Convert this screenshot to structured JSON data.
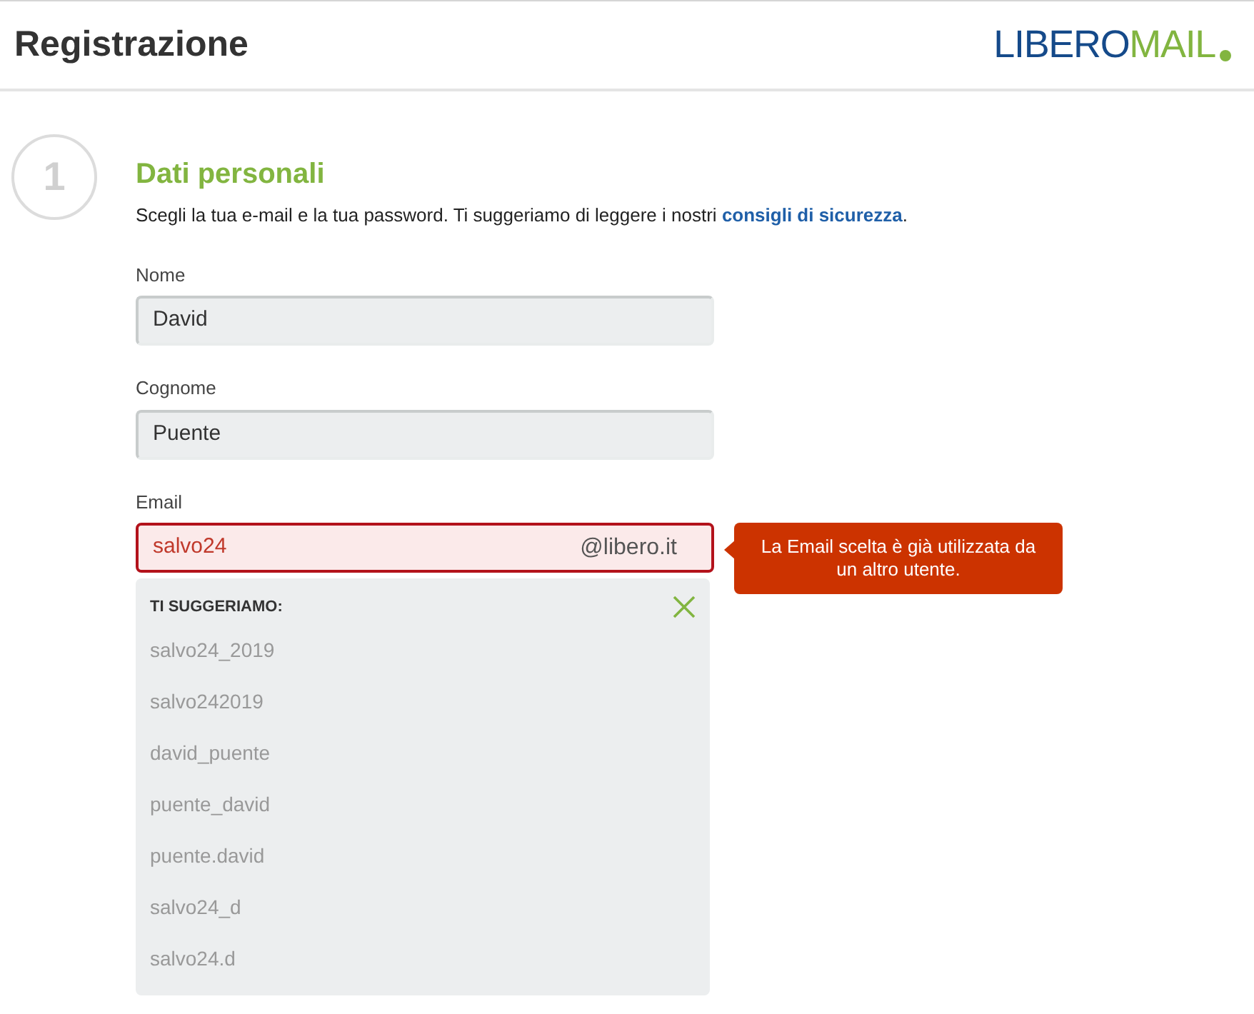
{
  "header": {
    "title": "Registrazione",
    "logo": {
      "part_1": "LIBERO",
      "part_2": "MAIL"
    }
  },
  "step": {
    "number": "1",
    "title": "Dati personali",
    "intro": "Scegli la tua e-mail e la tua password. Ti suggeriamo di leggere i nostri ",
    "link": "consigli di sicurezza",
    "intro_end": "."
  },
  "fields": [
    {
      "label": "Nome",
      "value": "David",
      "invalid": false
    },
    {
      "label": "Cognome",
      "value": "Puente",
      "invalid": false
    },
    {
      "label": "Email",
      "value": "salvo24",
      "suffix": "@libero.it",
      "invalid": true,
      "error": "La Email scelta è già utilizzata da un altro utente."
    }
  ],
  "suggestions": {
    "heading": "TI SUGGERIAMO:",
    "items": [
      "salvo24_2019",
      "salvo242019",
      "david_puente",
      "puente_david",
      "puente.david",
      "salvo24_d",
      "salvo24.d"
    ]
  }
}
